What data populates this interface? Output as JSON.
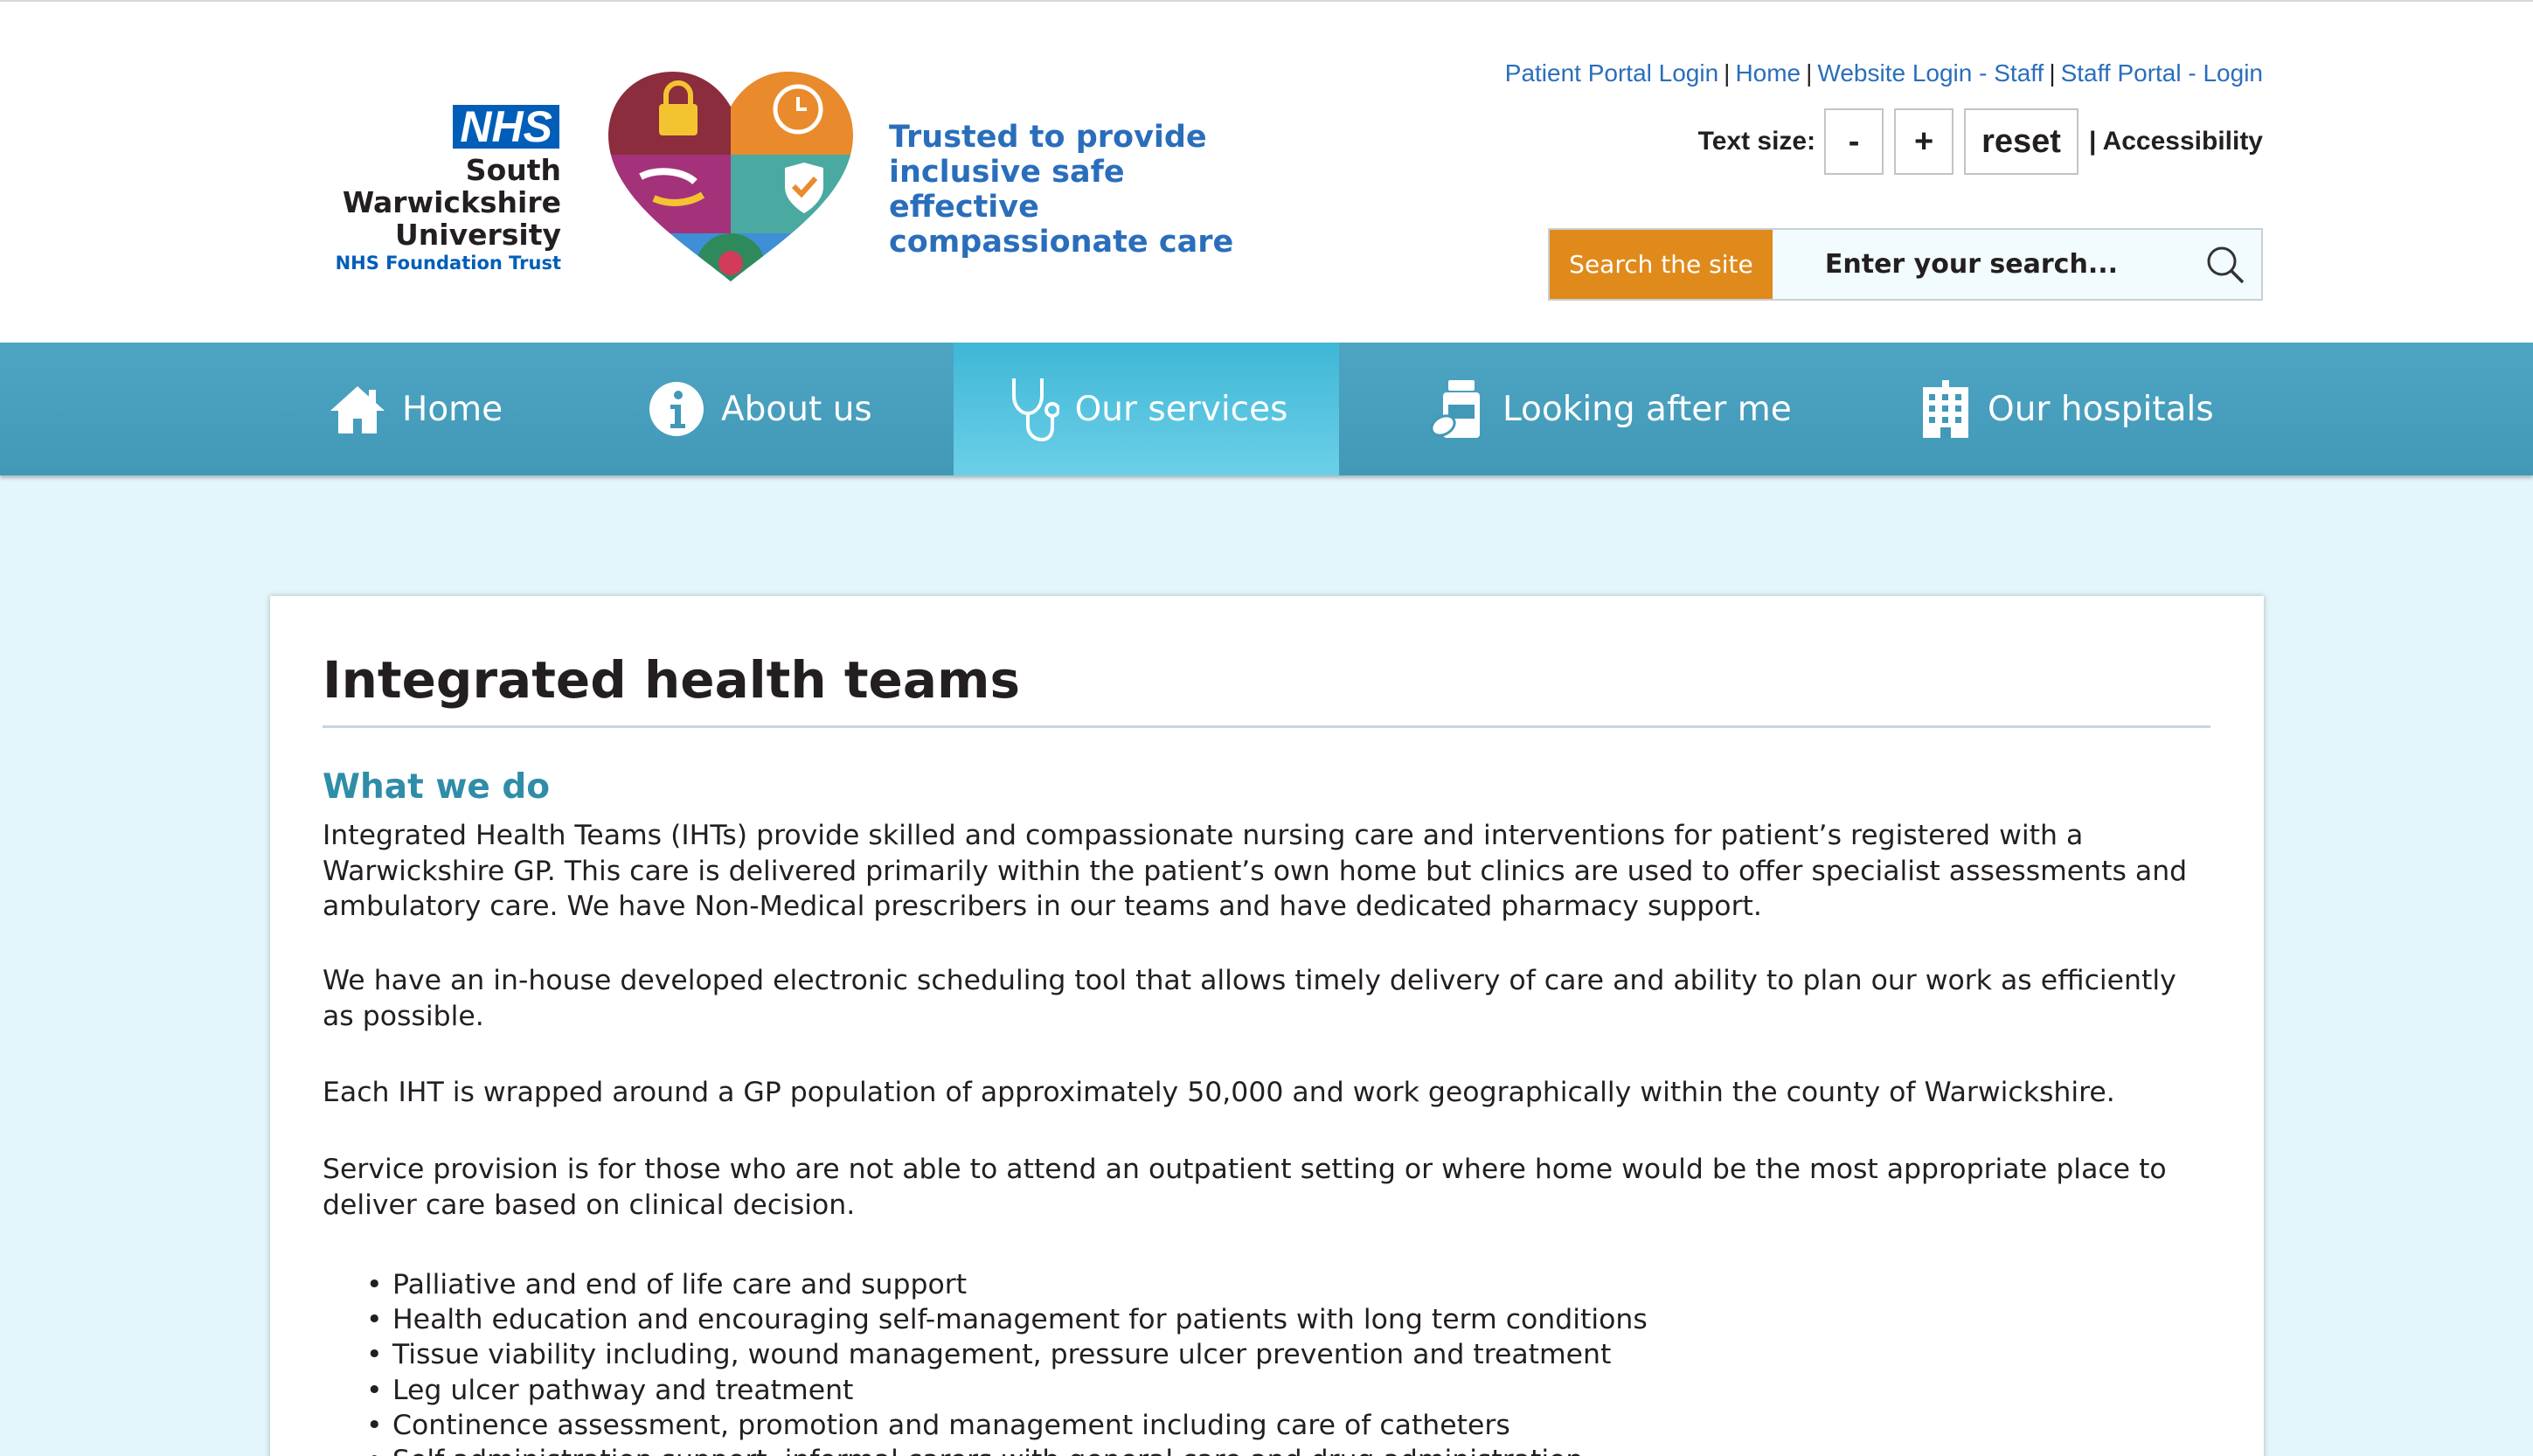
{
  "branding": {
    "nhs_badge": "NHS",
    "trust_name_line1": "South Warwickshire",
    "trust_name_line2": "University",
    "trust_subtitle": "NHS Foundation Trust",
    "tagline_line1": "Trusted to provide",
    "tagline_line2": "inclusive safe effective",
    "tagline_line3": "compassionate care",
    "colors": {
      "nhs_blue": "#005eb8",
      "tagline_blue": "#2a6ebb"
    }
  },
  "utility_links": [
    {
      "label": "Patient Portal Login"
    },
    {
      "label": "Home"
    },
    {
      "label": "Website Login - Staff"
    },
    {
      "label": "Staff Portal - Login"
    }
  ],
  "text_size": {
    "label": "Text size:",
    "decrease": "-",
    "increase": "+",
    "reset": "reset",
    "accessibility": "| Accessibility"
  },
  "search": {
    "label": "Search the site",
    "placeholder": "Enter your search...",
    "icon": "search-icon",
    "accent_color": "#e08a1c"
  },
  "nav": {
    "items": [
      {
        "label": "Home",
        "icon": "home-icon"
      },
      {
        "label": "About us",
        "icon": "info-icon"
      },
      {
        "label": "Our services",
        "icon": "stethoscope-icon",
        "active": true
      },
      {
        "label": "Looking after me",
        "icon": "medicine-icon"
      },
      {
        "label": "Our hospitals",
        "icon": "hospital-building-icon"
      }
    ],
    "colors": {
      "background": "#4298b7",
      "active": "#5cc6e2"
    }
  },
  "content": {
    "title": "Integrated health teams",
    "section_heading": "What we do",
    "paragraphs": [
      "Integrated Health Teams (IHTs) provide skilled and compassionate nursing care and interventions for patient’s registered with a Warwickshire GP. This care is delivered primarily within the patient’s own home but clinics are used to offer specialist assessments and ambulatory care. We have Non-Medical prescribers in our teams and have dedicated pharmacy support.",
      "We have an in-house developed electronic scheduling tool that allows timely delivery of care and ability to plan our work as efficiently as possible.",
      "Each IHT is wrapped around a GP population of approximately 50,000 and work geographically within the county of Warwickshire.",
      "Service provision is for those who are not able to attend an outpatient setting or where home would be the most appropriate place to deliver care based on clinical decision."
    ],
    "services": [
      "Palliative and end of life care and support",
      "Health education and encouraging self-management for patients with long term conditions",
      "Tissue viability including, wound management, pressure ulcer prevention and treatment",
      "Leg ulcer pathway and treatment",
      "Continence assessment, promotion and management including care of catheters",
      "Self-administration support, informal carers with general care and drug administration"
    ]
  }
}
